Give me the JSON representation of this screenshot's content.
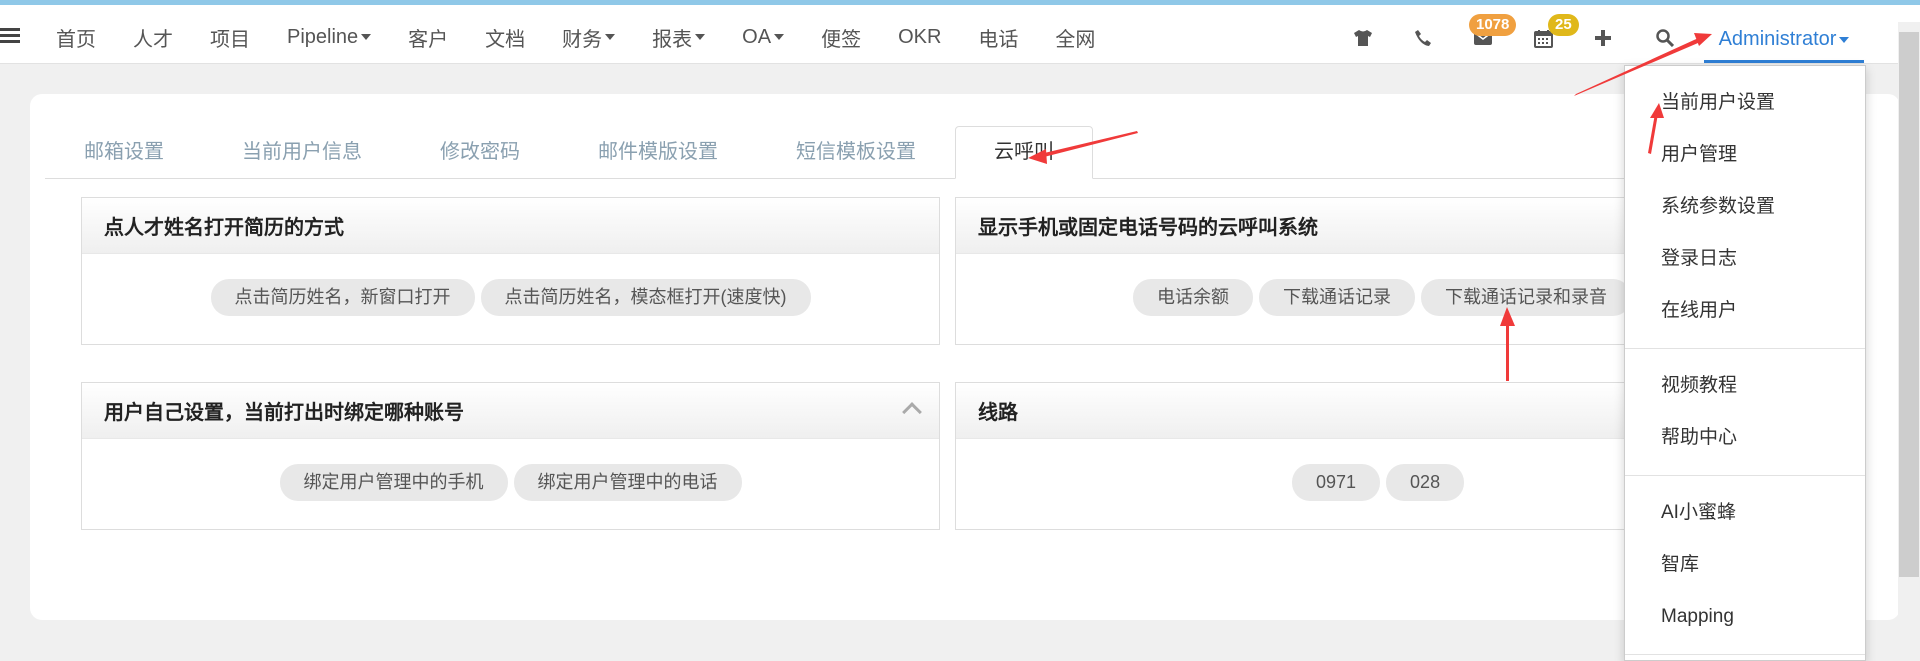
{
  "nav": {
    "items": [
      {
        "label": "首页",
        "caret": false
      },
      {
        "label": "人才",
        "caret": false
      },
      {
        "label": "项目",
        "caret": false
      },
      {
        "label": "Pipeline",
        "caret": true
      },
      {
        "label": "客户",
        "caret": false
      },
      {
        "label": "文档",
        "caret": false
      },
      {
        "label": "财务",
        "caret": true
      },
      {
        "label": "报表",
        "caret": true
      },
      {
        "label": "OA",
        "caret": true
      },
      {
        "label": "便签",
        "caret": false
      },
      {
        "label": "OKR",
        "caret": false
      },
      {
        "label": "电话",
        "caret": false
      },
      {
        "label": "全网",
        "caret": false
      }
    ]
  },
  "toolbar": {
    "mail_badge": "1078",
    "calendar_badge": "25",
    "user": "Administrator",
    "colors": {
      "mail_badge": "#f0a040",
      "calendar_badge": "#e0b81a",
      "accent": "#2f7fd5"
    },
    "icons": [
      "shirt-icon",
      "phone-icon",
      "mail-icon",
      "calendar-icon",
      "plus-icon",
      "search-icon"
    ]
  },
  "tabs": [
    "邮箱设置",
    "当前用户信息",
    "修改密码",
    "邮件模版设置",
    "短信模板设置",
    "云呼叫"
  ],
  "active_tab": 5,
  "panels": {
    "open_resume": {
      "title": "点人才姓名打开简历的方式",
      "options": [
        "点击简历姓名，新窗口打开",
        "点击简历姓名，模态框打开(速度快)"
      ]
    },
    "cloud_call": {
      "title": "显示手机或固定电话号码的云呼叫系统",
      "options": [
        "电话余额",
        "下载通话记录",
        "下载通话记录和录音"
      ]
    },
    "bind_account": {
      "title": "用户自己设置，当前打出时绑定哪种账号",
      "options": [
        "绑定用户管理中的手机",
        "绑定用户管理中的电话"
      ]
    },
    "line": {
      "title": "线路",
      "options": [
        "0971",
        "028"
      ]
    }
  },
  "dropdown": {
    "group1": [
      "当前用户设置",
      "用户管理",
      "系统参数设置",
      "登录日志",
      "在线用户"
    ],
    "group2": [
      "视频教程",
      "帮助中心"
    ],
    "group3": [
      "AI小蜜蜂",
      "智库",
      "Mapping"
    ]
  }
}
